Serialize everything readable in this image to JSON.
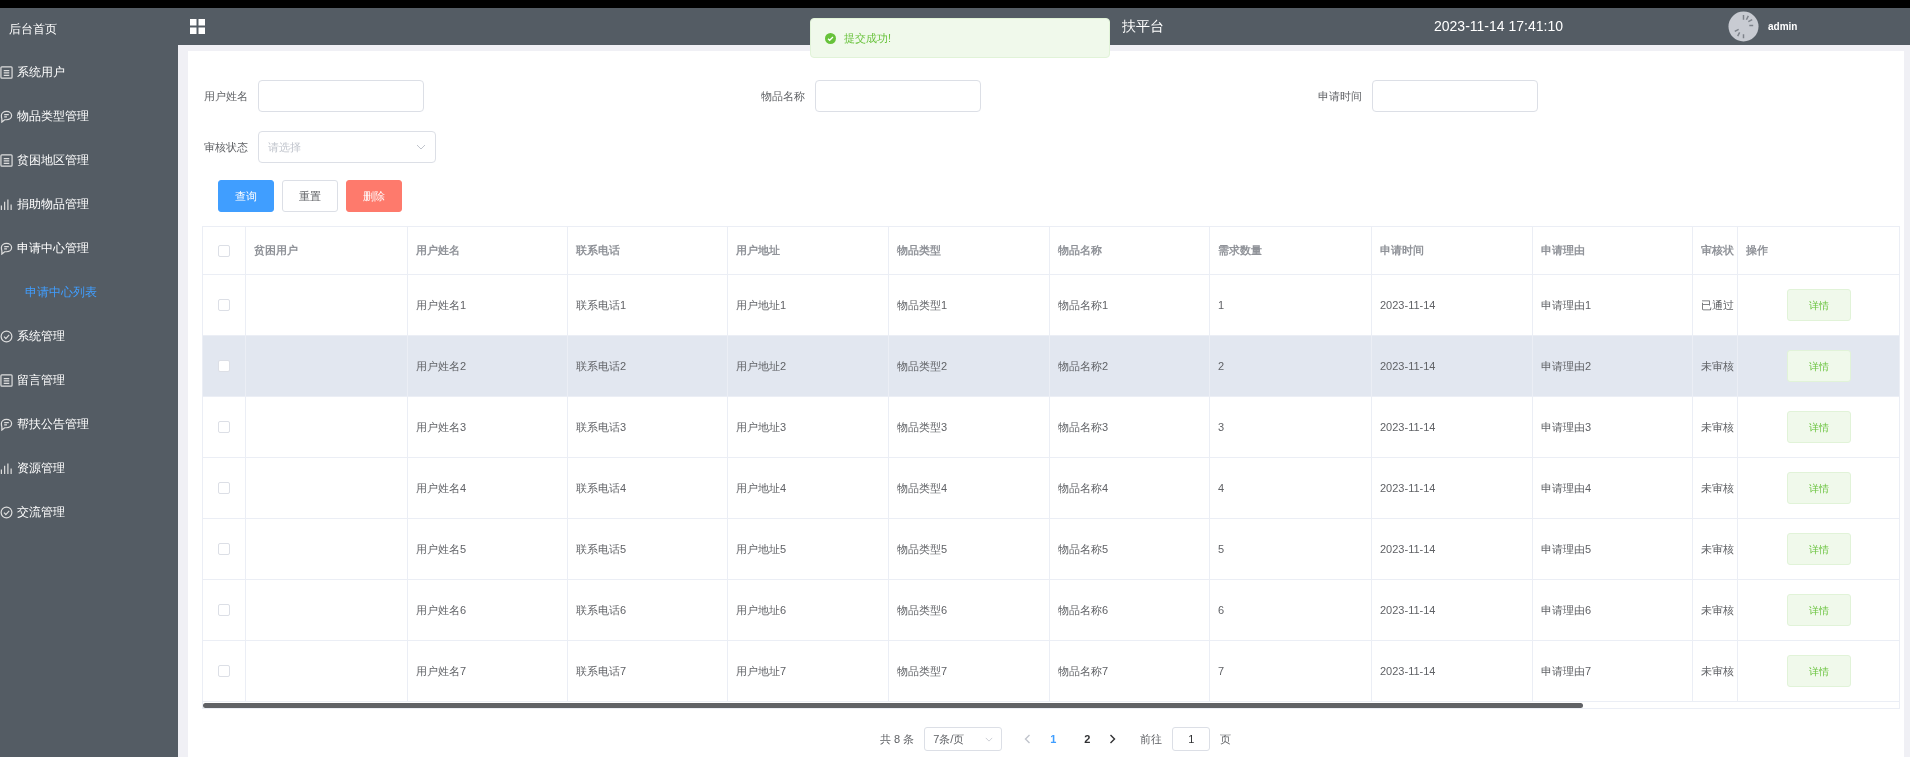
{
  "header": {
    "title": "扶平台",
    "datetime": "2023-11-14 17:41:10",
    "user": "admin"
  },
  "toast": {
    "message": "提交成功!"
  },
  "sidebar": {
    "home": "后台首页",
    "items": [
      {
        "label": "系统用户",
        "kind": "list"
      },
      {
        "label": "物品类型管理",
        "kind": "chat"
      },
      {
        "label": "贫困地区管理",
        "kind": "list"
      },
      {
        "label": "捐助物品管理",
        "kind": "bars"
      },
      {
        "label": "申请中心管理",
        "kind": "chat",
        "children": [
          {
            "label": "申请中心列表",
            "selected": true
          }
        ]
      },
      {
        "label": "系统管理",
        "kind": "check"
      },
      {
        "label": "留言管理",
        "kind": "list"
      },
      {
        "label": "帮扶公告管理",
        "kind": "chat"
      },
      {
        "label": "资源管理",
        "kind": "bars"
      },
      {
        "label": "交流管理",
        "kind": "check"
      }
    ]
  },
  "filters": [
    {
      "label": "用户姓名",
      "kind": "input"
    },
    {
      "label": "物品名称",
      "kind": "input"
    },
    {
      "label": "申请时间",
      "kind": "input"
    },
    {
      "label": "审核状态",
      "kind": "select",
      "placeholder": "请选择"
    }
  ],
  "buttons": [
    {
      "label": "查询",
      "kind": "primary"
    },
    {
      "label": "重置",
      "kind": "default"
    },
    {
      "label": "删除",
      "kind": "danger"
    }
  ],
  "table": {
    "header_checked": false,
    "columns": [
      "贫困用户",
      "用户姓名",
      "联系电话",
      "用户地址",
      "物品类型",
      "物品名称",
      "需求数量",
      "申请时间",
      "申请理由",
      "审核状",
      "操作"
    ],
    "rows": [
      {
        "checked": false,
        "highlighted": false,
        "cells": [
          "",
          "用户姓名1",
          "联系电话1",
          "用户地址1",
          "物品类型1",
          "物品名称1",
          "1",
          "2023-11-14",
          "申请理由1",
          "已通过"
        ],
        "action": "详情"
      },
      {
        "checked": false,
        "highlighted": true,
        "cells": [
          "",
          "用户姓名2",
          "联系电话2",
          "用户地址2",
          "物品类型2",
          "物品名称2",
          "2",
          "2023-11-14",
          "申请理由2",
          "未审核"
        ],
        "action": "详情"
      },
      {
        "checked": false,
        "highlighted": false,
        "cells": [
          "",
          "用户姓名3",
          "联系电话3",
          "用户地址3",
          "物品类型3",
          "物品名称3",
          "3",
          "2023-11-14",
          "申请理由3",
          "未审核"
        ],
        "action": "详情"
      },
      {
        "checked": false,
        "highlighted": false,
        "cells": [
          "",
          "用户姓名4",
          "联系电话4",
          "用户地址4",
          "物品类型4",
          "物品名称4",
          "4",
          "2023-11-14",
          "申请理由4",
          "未审核"
        ],
        "action": "详情"
      },
      {
        "checked": false,
        "highlighted": false,
        "cells": [
          "",
          "用户姓名5",
          "联系电话5",
          "用户地址5",
          "物品类型5",
          "物品名称5",
          "5",
          "2023-11-14",
          "申请理由5",
          "未审核"
        ],
        "action": "详情"
      },
      {
        "checked": false,
        "highlighted": false,
        "cells": [
          "",
          "用户姓名6",
          "联系电话6",
          "用户地址6",
          "物品类型6",
          "物品名称6",
          "6",
          "2023-11-14",
          "申请理由6",
          "未审核"
        ],
        "action": "详情"
      },
      {
        "checked": false,
        "highlighted": false,
        "cells": [
          "",
          "用户姓名7",
          "联系电话7",
          "用户地址7",
          "物品类型7",
          "物品名称7",
          "7",
          "2023-11-14",
          "申请理由7",
          "未审核"
        ],
        "action": "详情"
      }
    ]
  },
  "pagination": {
    "total": "共 8 条",
    "page_size": "7条/页",
    "pages": [
      {
        "label": "1",
        "selected": true
      },
      {
        "label": "2",
        "selected": false
      }
    ],
    "goto_label": "前往",
    "goto_value": "1",
    "suffix": "页"
  }
}
